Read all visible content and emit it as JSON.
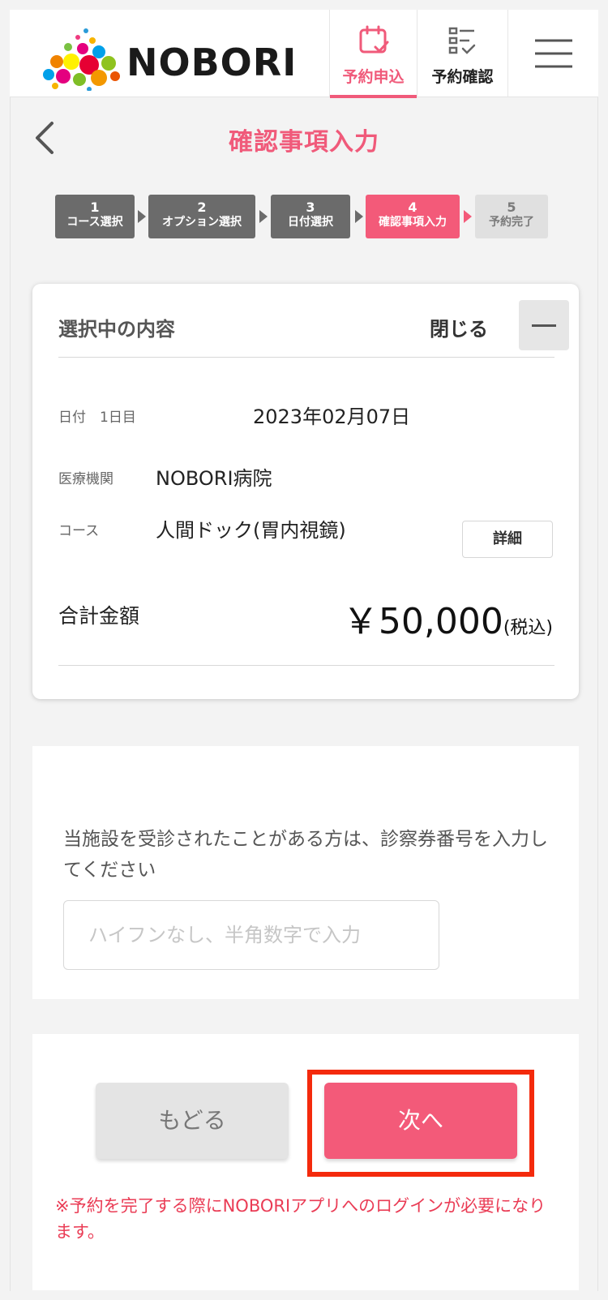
{
  "header": {
    "logo_text": "NOBORI",
    "tabs": [
      {
        "label": "予約申込",
        "active": true
      },
      {
        "label": "予約確認",
        "active": false
      }
    ],
    "menu_icon": "hamburger-icon"
  },
  "page": {
    "title": "確認事項入力",
    "back_icon": "chevron-left-icon"
  },
  "steps": [
    {
      "num": "1",
      "label": "コース選択",
      "state": "done"
    },
    {
      "num": "2",
      "label": "オプション選択",
      "state": "done"
    },
    {
      "num": "3",
      "label": "日付選択",
      "state": "done"
    },
    {
      "num": "4",
      "label": "確認事項入力",
      "state": "active"
    },
    {
      "num": "5",
      "label": "予約完了",
      "state": "todo"
    }
  ],
  "summary": {
    "title": "選択中の内容",
    "close_label": "閉じる",
    "date_label": "日付　1日目",
    "date_value": "2023年02月07日",
    "facility_label": "医療機関",
    "facility_value": "NOBORI病院",
    "course_label": "コース",
    "course_value": "人間ドック(胃内視鏡)",
    "detail_button": "詳細",
    "total_label": "合計金額",
    "total_amount": "￥50,000",
    "total_tax": "(税込)"
  },
  "patient": {
    "prompt": "当施設を受診されたことがある方は、診察券番号を入力してください",
    "input_value": "",
    "input_placeholder": "ハイフンなし、半角数字で入力"
  },
  "actions": {
    "back_label": "もどる",
    "next_label": "次へ",
    "notice": "※予約を完了する際にNOBORIアプリへのログインが必要になります。"
  },
  "colors": {
    "accent": "#f05a7a",
    "step_done": "#6b6b6b",
    "step_todo": "#e0e0e0",
    "highlight": "#f42a0c"
  }
}
